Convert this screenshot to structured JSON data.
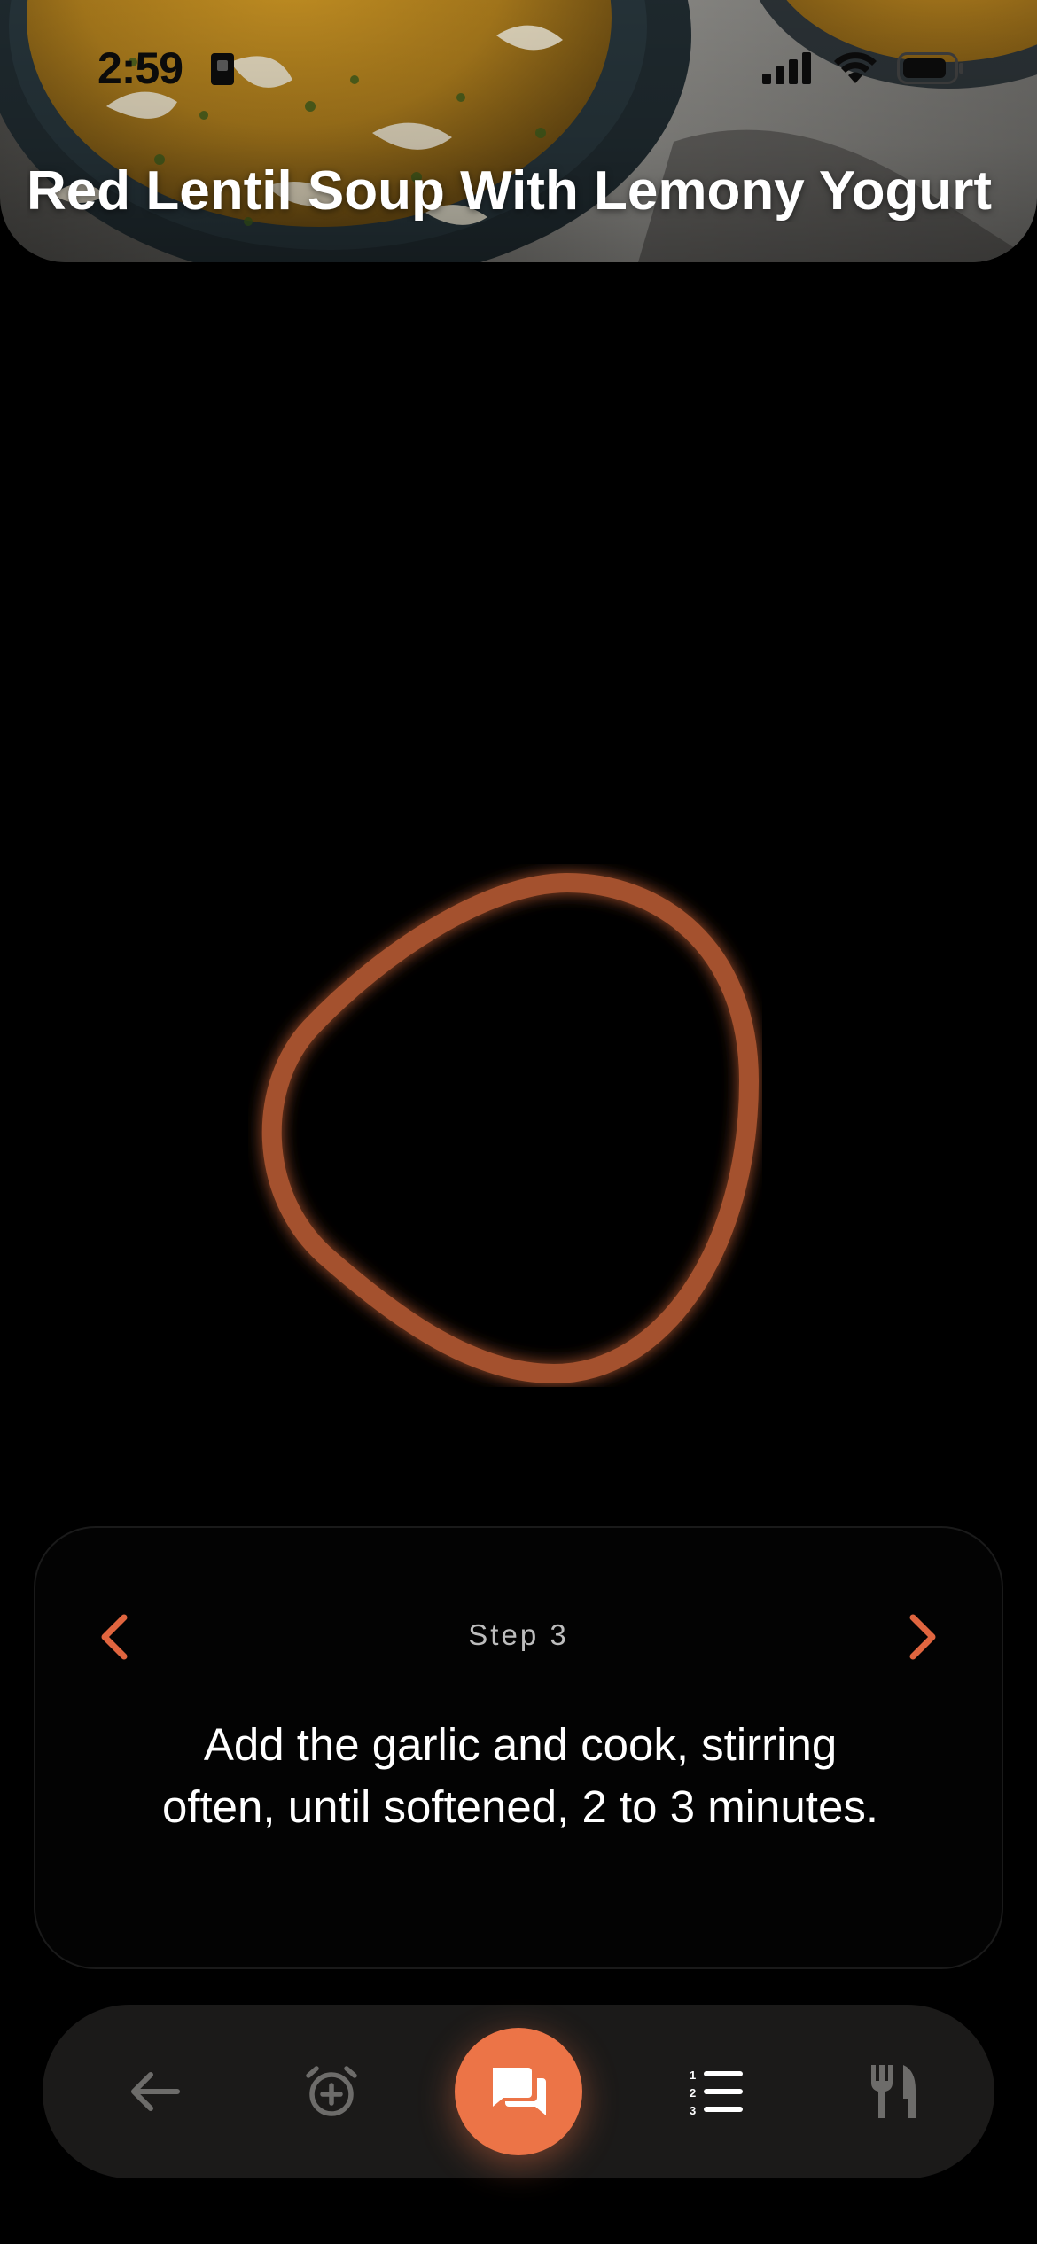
{
  "status_bar": {
    "time": "2:59",
    "icons": [
      "lock-icon",
      "signal-icon",
      "wifi-icon",
      "battery-icon"
    ]
  },
  "header": {
    "title": "Red Lentil Soup With Lemony Yogurt"
  },
  "voice": {
    "state_icon": "listening-ring",
    "ring_color": "#a4512f"
  },
  "step_card": {
    "step_label": "Step 3",
    "instruction": "Add the garlic and cook, stirring often, until softened, 2 to 3 minutes.",
    "prev_icon": "chevron-left-icon",
    "next_icon": "chevron-right-icon",
    "accent": "#e0653f"
  },
  "toolbar": {
    "items": [
      {
        "icon": "back-arrow-icon"
      },
      {
        "icon": "add-timer-icon"
      },
      {
        "icon": "chat-icon",
        "active": true
      },
      {
        "icon": "numbered-list-icon"
      },
      {
        "icon": "utensils-icon"
      }
    ],
    "accent": "#ec7447"
  }
}
